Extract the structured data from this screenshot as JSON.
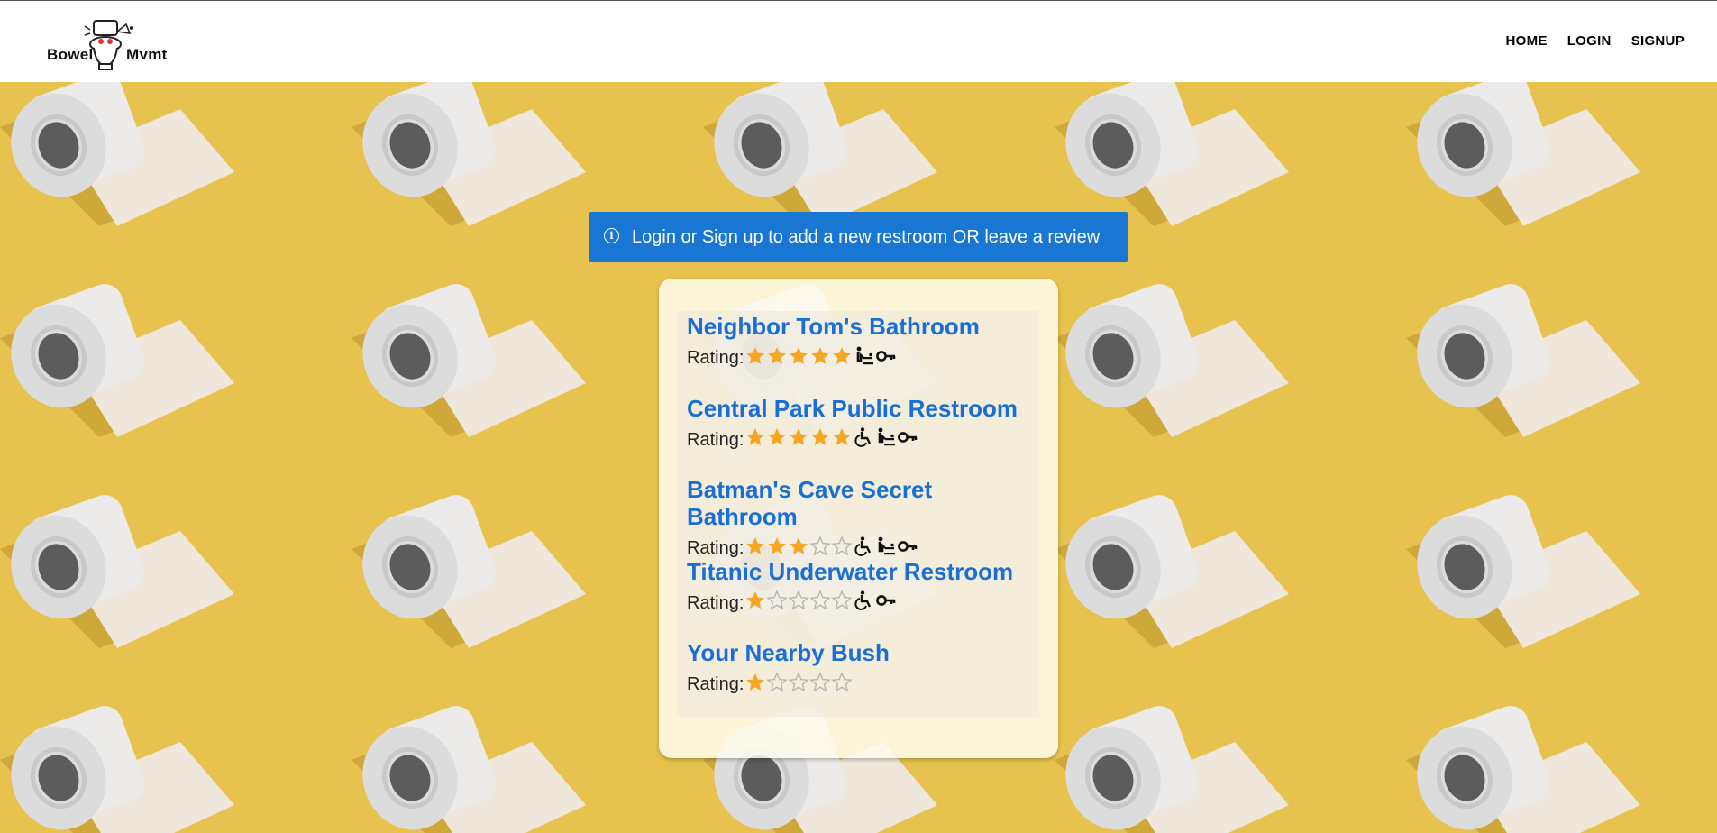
{
  "header": {
    "logo_left": "Bowel",
    "logo_right": "Mvmt",
    "nav": [
      {
        "label": "HOME"
      },
      {
        "label": "LOGIN"
      },
      {
        "label": "SIGNUP"
      }
    ]
  },
  "alert": {
    "icon": "info-icon",
    "text": "Login or Sign up to add a new restroom OR leave a review"
  },
  "restrooms": [
    {
      "name": "Neighbor Tom's Bathroom",
      "rating_label": "Rating:",
      "rating": 5,
      "amenities": [
        "baby-changing-icon",
        "key-icon"
      ]
    },
    {
      "name": "Central Park Public Restroom",
      "rating_label": "Rating:",
      "rating": 5,
      "amenities": [
        "wheelchair-icon",
        "baby-changing-icon",
        "key-icon"
      ]
    },
    {
      "name": "Batman's Cave Secret Bathroom",
      "rating_label": "Rating:",
      "rating": 3,
      "amenities": [
        "wheelchair-icon",
        "baby-changing-icon",
        "key-icon"
      ]
    },
    {
      "name": "Titanic Underwater Restroom",
      "rating_label": "Rating:",
      "rating": 1,
      "amenities": [
        "wheelchair-icon",
        "key-icon"
      ]
    },
    {
      "name": "Your Nearby Bush",
      "rating_label": "Rating:",
      "rating": 1,
      "amenities": []
    }
  ],
  "rating_max": 5,
  "colors": {
    "star_filled": "#f5a623",
    "star_empty": "#b5b5b5",
    "link": "#1a6fd6",
    "alert": "#1976d2",
    "background": "#e8c24e"
  }
}
